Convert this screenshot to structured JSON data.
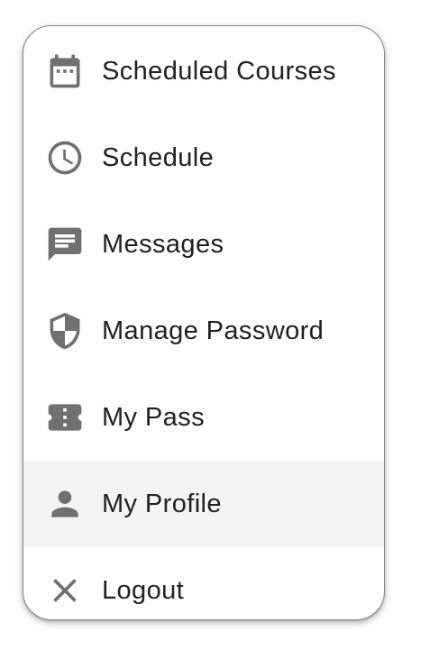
{
  "menu": {
    "items": [
      {
        "label": "Scheduled Courses",
        "icon": "calendar-icon"
      },
      {
        "label": "Schedule",
        "icon": "clock-icon"
      },
      {
        "label": "Messages",
        "icon": "message-icon"
      },
      {
        "label": "Manage Password",
        "icon": "shield-icon"
      },
      {
        "label": "My Pass",
        "icon": "ticket-icon"
      },
      {
        "label": "My Profile",
        "icon": "person-icon"
      },
      {
        "label": "Logout",
        "icon": "close-icon"
      }
    ],
    "active_item": "My Profile"
  },
  "colors": {
    "icon": "#707070",
    "text": "#212121",
    "active_background": "#f4f4f4",
    "border": "#8a8a8a"
  }
}
